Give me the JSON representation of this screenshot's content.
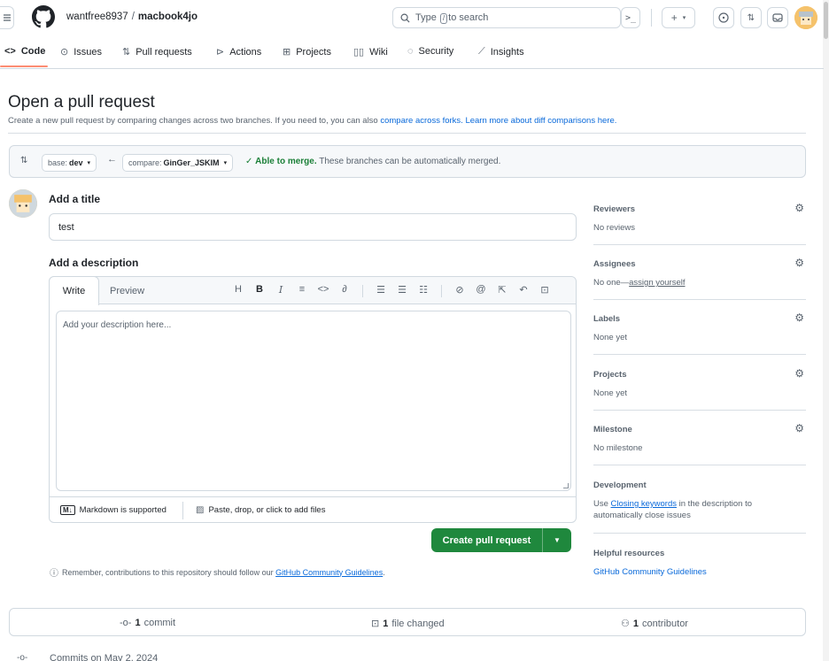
{
  "header": {
    "owner": "wantfree8937",
    "separator": "/",
    "repo": "macbook4jo",
    "search_pre": "Type",
    "search_key": "/",
    "search_post": "to search"
  },
  "nav": {
    "items": [
      {
        "label": "Code"
      },
      {
        "label": "Issues"
      },
      {
        "label": "Pull requests"
      },
      {
        "label": "Actions"
      },
      {
        "label": "Projects"
      },
      {
        "label": "Wiki"
      },
      {
        "label": "Security"
      },
      {
        "label": "Insights"
      }
    ]
  },
  "page": {
    "title": "Open a pull request",
    "subtitle_pre": "Create a new pull request by comparing changes across two branches. If you need to, you can also",
    "subtitle_link1": "compare across forks.",
    "subtitle_link2": "Learn more about diff comparisons here."
  },
  "compare": {
    "base_label": "base:",
    "base_value": "dev",
    "compare_label": "compare:",
    "compare_value": "GinGer_JSKIM",
    "merge_ok": "Able to merge.",
    "merge_text": "These branches can be automatically merged."
  },
  "form": {
    "title_label": "Add a title",
    "title_value": "test",
    "description_label": "Add a description",
    "tab_write": "Write",
    "tab_preview": "Preview",
    "placeholder": "Add your description here...",
    "markdown_note": "Markdown is supported",
    "attach_note": "Paste, drop, or click to add files",
    "create_button": "Create pull request",
    "remember_pre": "Remember, contributions to this repository should follow our",
    "remember_link": "GitHub Community Guidelines",
    "remember_post": "."
  },
  "sidebar": {
    "reviewers": {
      "title": "Reviewers",
      "value": "No reviews"
    },
    "assignees": {
      "title": "Assignees",
      "value_pre": "No one—",
      "value_link": "assign yourself"
    },
    "labels": {
      "title": "Labels",
      "value": "None yet"
    },
    "projects": {
      "title": "Projects",
      "value": "None yet"
    },
    "milestone": {
      "title": "Milestone",
      "value": "No milestone"
    },
    "development": {
      "title": "Development",
      "value_pre": "Use",
      "value_link": "Closing keywords",
      "value_post": "in the description to automatically close issues"
    },
    "helpful": {
      "title": "Helpful resources",
      "link": "GitHub Community Guidelines"
    }
  },
  "stats": {
    "commit_count": "1",
    "commit_label": "commit",
    "files_count": "1",
    "files_label": "file changed",
    "contrib_count": "1",
    "contrib_label": "contributor"
  },
  "commits_on": "Commits on May 2, 2024",
  "colors": {
    "accent": "#0969da",
    "success": "#1f883d",
    "nav_underline": "#fd8c73"
  }
}
